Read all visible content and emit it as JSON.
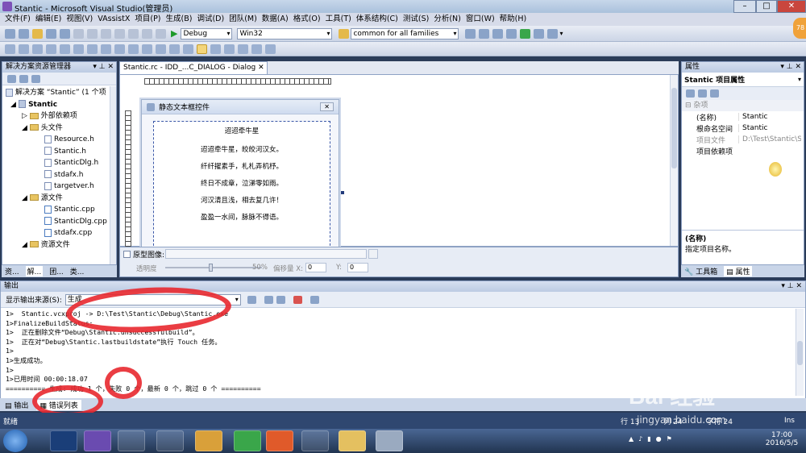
{
  "window": {
    "title": "Stantic - Microsoft Visual Studio(管理员)",
    "min": "–",
    "max": "□",
    "close": "✕"
  },
  "menu": [
    "文件(F)",
    "编辑(E)",
    "视图(V)",
    "VAssistX",
    "项目(P)",
    "生成(B)",
    "调试(D)",
    "团队(M)",
    "数据(A)",
    "格式(O)",
    "工具(T)",
    "体系结构(C)",
    "测试(S)",
    "分析(N)",
    "窗口(W)",
    "帮助(H)"
  ],
  "toolbar": {
    "config": "Debug",
    "platform": "Win32",
    "find": "common for all families",
    "badge": "78"
  },
  "solution_explorer": {
    "title": "解决方案资源管理器",
    "items": [
      {
        "label": "解决方案 “Stantic” (1 个项"
      },
      {
        "label": "Stantic"
      },
      {
        "label": "外部依赖项"
      },
      {
        "label": "头文件"
      },
      {
        "label": "Resource.h"
      },
      {
        "label": "Stantic.h"
      },
      {
        "label": "StanticDlg.h"
      },
      {
        "label": "stdafx.h"
      },
      {
        "label": "targetver.h"
      },
      {
        "label": "源文件"
      },
      {
        "label": "Stantic.cpp"
      },
      {
        "label": "StanticDlg.cpp"
      },
      {
        "label": "stdafx.cpp"
      },
      {
        "label": "资源文件"
      }
    ],
    "tabs": [
      "资...",
      "解...",
      "团...",
      "类..."
    ]
  },
  "editor": {
    "tab": "Stantic.rc - IDD_...C_DIALOG - Dialog",
    "dialog_title": "静态文本框控件",
    "close": "✕",
    "poem": [
      "迢迢牵牛星",
      "迢迢牵牛星，皎皎河汉女。",
      "纤纤擢素手，札札弄机杼。",
      "终日不成章，泣涕零如雨。",
      "河汉清且浅，相去复几许！",
      "盈盈一水间，脉脉不得语。"
    ],
    "proto_label": "原型图像:",
    "transparency_label": "透明度",
    "transparency_value": "50%",
    "offset_x_label": "偏移量 X:",
    "offset_x": "0",
    "offset_y_label": "Y:",
    "offset_y": "0"
  },
  "properties": {
    "title": "属性",
    "object": "Stantic 项目属性",
    "category": "杂项",
    "rows": [
      {
        "name": "(名称)",
        "value": "Stantic"
      },
      {
        "name": "根命名空间",
        "value": "Stantic"
      },
      {
        "name": "项目文件",
        "value": "D:\\Test\\Stantic\\Sta"
      },
      {
        "name": "项目依赖项",
        "value": ""
      }
    ],
    "desc_title": "(名称)",
    "desc_text": "指定项目名称。",
    "tabs": [
      "工具箱",
      "属性"
    ]
  },
  "output": {
    "title": "输出",
    "source_label": "显示输出来源(S):",
    "source_value": "生成",
    "lines": [
      "1>  Stantic.vcxproj -> D:\\Test\\Stantic\\Debug\\Stantic.exe",
      "1>FinalizeBuildStatus:",
      "1>  正在删除文件“Debug\\Stantic.unsuccessfulbuild”。",
      "1>  正在对“Debug\\Stantic.lastbuildstate”执行 Touch 任务。",
      "1>",
      "1>生成成功。",
      "1>",
      "1>已用时间 00:00:18.07",
      "========== 生成: 成功 1 个，失败 0 个，最新 0 个，跳过 0 个 =========="
    ],
    "tabs": [
      "输出",
      "错误列表"
    ]
  },
  "status": {
    "ready": "就绪",
    "line": "行 13",
    "col": "列 24",
    "char": "字符 24",
    "ins": "Ins"
  },
  "taskbar": {
    "time": "17:00",
    "date": "2016/5/5"
  },
  "watermark": {
    "brand": "Bai 经验",
    "url": "jingyan.baidu.com"
  }
}
